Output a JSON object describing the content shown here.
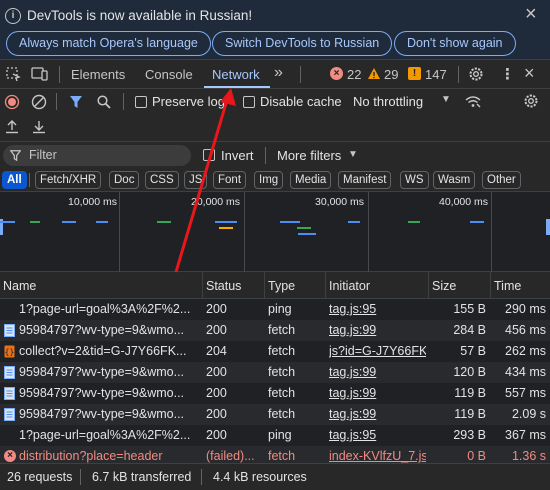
{
  "infobar": {
    "message": "DevTools is now available in Russian!",
    "buttons": [
      "Always match Opera's language",
      "Switch DevTools to Russian",
      "Don't show again"
    ]
  },
  "tabs": {
    "items": [
      "Elements",
      "Console",
      "Network"
    ],
    "active": "Network",
    "more": "»",
    "errors": "22",
    "warnings": "29",
    "issues": "147"
  },
  "toolbar": {
    "preserve_log": "Preserve log",
    "disable_cache": "Disable cache",
    "throttling": "No throttling"
  },
  "filter": {
    "placeholder": "Filter",
    "invert": "Invert",
    "more_filters": "More filters",
    "types": [
      "All",
      "Fetch/XHR",
      "Doc",
      "CSS",
      "JS",
      "Font",
      "Img",
      "Media",
      "Manifest",
      "WS",
      "Wasm",
      "Other"
    ],
    "selected_type": "All"
  },
  "overview": {
    "ticks": [
      "10,000 ms",
      "20,000 ms",
      "30,000 ms",
      "40,000 ms"
    ]
  },
  "table": {
    "columns": [
      "Name",
      "Status",
      "Type",
      "Initiator",
      "Size",
      "Time"
    ],
    "rows": [
      {
        "name": "1?page-url=goal%3A%2F%2...",
        "status": "200",
        "type": "ping",
        "initiator": "tag.js:95",
        "size": "155 B",
        "time": "290 ms",
        "icon": "blank-icon"
      },
      {
        "name": "95984797?wv-type=9&wmo...",
        "status": "200",
        "type": "fetch",
        "initiator": "tag.js:99",
        "size": "284 B",
        "time": "456 ms",
        "icon": "document-icon"
      },
      {
        "name": "collect?v=2&tid=G-J7Y66FK...",
        "status": "204",
        "type": "fetch",
        "initiator": "js?id=G-J7Y66FK",
        "size": "57 B",
        "time": "262 ms",
        "icon": "braces-icon"
      },
      {
        "name": "95984797?wv-type=9&wmo...",
        "status": "200",
        "type": "fetch",
        "initiator": "tag.js:99",
        "size": "120 B",
        "time": "434 ms",
        "icon": "document-icon"
      },
      {
        "name": "95984797?wv-type=9&wmo...",
        "status": "200",
        "type": "fetch",
        "initiator": "tag.js:99",
        "size": "119 B",
        "time": "557 ms",
        "icon": "document-icon"
      },
      {
        "name": "95984797?wv-type=9&wmo...",
        "status": "200",
        "type": "fetch",
        "initiator": "tag.js:99",
        "size": "119 B",
        "time": "2.09 s",
        "icon": "document-icon"
      },
      {
        "name": "1?page-url=goal%3A%2F%2...",
        "status": "200",
        "type": "ping",
        "initiator": "tag.js:95",
        "size": "293 B",
        "time": "367 ms",
        "icon": "blank-icon"
      },
      {
        "name": "distribution?place=header",
        "status": "(failed)...",
        "type": "fetch",
        "initiator": "index-KVlfzU_7.js",
        "size": "0 B",
        "time": "1.36 s",
        "icon": "error-icon"
      }
    ]
  },
  "statusbar": {
    "requests": "26 requests",
    "transferred": "6.7 kB transferred",
    "resources": "4.4 kB resources"
  },
  "colors": {
    "accent": "#a8c7fa",
    "error": "#f28b82",
    "warning": "#f29900",
    "annotation_arrow": "#e8171b"
  }
}
